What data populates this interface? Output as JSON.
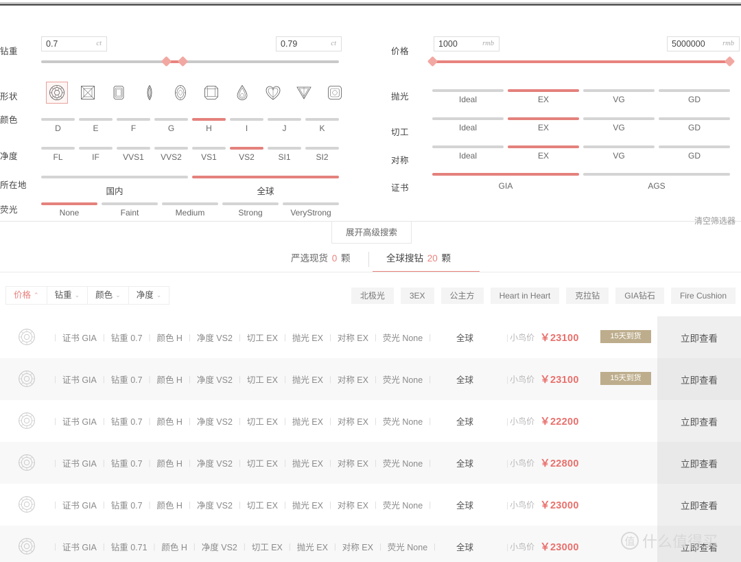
{
  "carat": {
    "label": "钻重",
    "min_value": "0.7",
    "max_value": "0.79",
    "unit": "ct",
    "placeholder": "ct"
  },
  "shape": {
    "label": "形状",
    "items": [
      {
        "name": "round-shape-icon",
        "selected": true
      },
      {
        "name": "princess-shape-icon",
        "selected": false
      },
      {
        "name": "emerald-shape-icon",
        "selected": false
      },
      {
        "name": "marquise-shape-icon",
        "selected": false
      },
      {
        "name": "oval-shape-icon",
        "selected": false
      },
      {
        "name": "radiant-shape-icon",
        "selected": false
      },
      {
        "name": "pear-shape-icon",
        "selected": false
      },
      {
        "name": "heart-shape-icon",
        "selected": false
      },
      {
        "name": "triangle-shape-icon",
        "selected": false
      },
      {
        "name": "cushion-shape-icon",
        "selected": false
      }
    ]
  },
  "color": {
    "label": "颜色",
    "options": [
      "D",
      "E",
      "F",
      "G",
      "H",
      "I",
      "J",
      "K"
    ],
    "selected": [
      "H"
    ]
  },
  "clarity": {
    "label": "净度",
    "options": [
      "FL",
      "IF",
      "VVS1",
      "VVS2",
      "VS1",
      "VS2",
      "SI1",
      "SI2"
    ],
    "selected": [
      "VS2"
    ]
  },
  "location": {
    "label": "所在地",
    "options": [
      "国内",
      "全球"
    ],
    "selected": [
      "全球"
    ]
  },
  "fluorescence": {
    "label": "荧光",
    "options": [
      "None",
      "Faint",
      "Medium",
      "Strong",
      "VeryStrong"
    ],
    "selected": [
      "None"
    ]
  },
  "price": {
    "label": "价格",
    "min_value": "1000",
    "max_value": "5000000",
    "unit": "rmb"
  },
  "polish": {
    "label": "抛光",
    "options": [
      "Ideal",
      "EX",
      "VG",
      "GD"
    ],
    "selected": [
      "EX"
    ]
  },
  "cut": {
    "label": "切工",
    "options": [
      "Ideal",
      "EX",
      "VG",
      "GD"
    ],
    "selected": [
      "EX"
    ]
  },
  "symmetry": {
    "label": "对称",
    "options": [
      "Ideal",
      "EX",
      "VG",
      "GD"
    ],
    "selected": [
      "EX"
    ]
  },
  "certificate": {
    "label": "证书",
    "options": [
      "GIA",
      "AGS"
    ],
    "selected": [
      "GIA"
    ]
  },
  "advanced_tab_label": "展开高级搜索",
  "clear_filters_label": "清空筛选器",
  "result_tabs": [
    {
      "label": "严选现货",
      "count": "0",
      "unit": "颗",
      "active": false
    },
    {
      "label": "全球搜钻",
      "count": "20",
      "unit": "颗",
      "active": true
    }
  ],
  "sort_bar": [
    {
      "label": "价格",
      "chevron": "chevron-up-icon",
      "glyph": "⌃",
      "active": true
    },
    {
      "label": "钻重",
      "chevron": "chevron-down-icon",
      "glyph": "⌄",
      "active": false
    },
    {
      "label": "颜色",
      "chevron": "chevron-down-icon",
      "glyph": "⌄",
      "active": false
    },
    {
      "label": "净度",
      "chevron": "chevron-down-icon",
      "glyph": "⌄",
      "active": false
    }
  ],
  "quick_tags": [
    "北极光",
    "3EX",
    "公主方",
    "Heart in Heart",
    "克拉钻",
    "GIA钻石",
    "Fire Cushion"
  ],
  "row_field_labels": {
    "cert": "证书",
    "carat": "钻重",
    "color": "颜色",
    "clarity": "净度",
    "cut": "切工",
    "polish": "抛光",
    "symmetry": "对称",
    "fluorescence": "荧光",
    "price_label": "小鸟价",
    "currency": "￥"
  },
  "view_button_label": "立即查看",
  "rows": [
    {
      "shape_icon": "round-diamond-icon",
      "cert": "GIA",
      "carat": "0.7",
      "color": "H",
      "clarity": "VS2",
      "cut": "EX",
      "polish": "EX",
      "symmetry": "EX",
      "fluorescence": "None",
      "origin": "全球",
      "price_label": "小鸟价",
      "price": "￥23100",
      "badge": "15天到货",
      "action": "立即查看"
    },
    {
      "shape_icon": "round-diamond-icon",
      "cert": "GIA",
      "carat": "0.7",
      "color": "H",
      "clarity": "VS2",
      "cut": "EX",
      "polish": "EX",
      "symmetry": "EX",
      "fluorescence": "None",
      "origin": "全球",
      "price_label": "小鸟价",
      "price": "￥23100",
      "badge": "15天到货",
      "action": "立即查看"
    },
    {
      "shape_icon": "round-diamond-icon",
      "cert": "GIA",
      "carat": "0.7",
      "color": "H",
      "clarity": "VS2",
      "cut": "EX",
      "polish": "EX",
      "symmetry": "EX",
      "fluorescence": "None",
      "origin": "全球",
      "price_label": "小鸟价",
      "price": "￥22200",
      "badge": "",
      "action": "立即查看"
    },
    {
      "shape_icon": "round-diamond-icon",
      "cert": "GIA",
      "carat": "0.7",
      "color": "H",
      "clarity": "VS2",
      "cut": "EX",
      "polish": "EX",
      "symmetry": "EX",
      "fluorescence": "None",
      "origin": "全球",
      "price_label": "小鸟价",
      "price": "￥22800",
      "badge": "",
      "action": "立即查看"
    },
    {
      "shape_icon": "round-diamond-icon",
      "cert": "GIA",
      "carat": "0.7",
      "color": "H",
      "clarity": "VS2",
      "cut": "EX",
      "polish": "EX",
      "symmetry": "EX",
      "fluorescence": "None",
      "origin": "全球",
      "price_label": "小鸟价",
      "price": "￥23000",
      "badge": "",
      "action": "立即查看"
    },
    {
      "shape_icon": "round-diamond-icon",
      "cert": "GIA",
      "carat": "0.71",
      "color": "H",
      "clarity": "VS2",
      "cut": "EX",
      "polish": "EX",
      "symmetry": "EX",
      "fluorescence": "None",
      "origin": "全球",
      "price_label": "小鸟价",
      "price": "￥23000",
      "badge": "",
      "action": "立即查看"
    }
  ],
  "watermark": {
    "mark": "值",
    "text": "什么值得买"
  },
  "colors": {
    "accent": "#e8827d",
    "track": "#d4d4d4",
    "badge": "#bdad8c",
    "price": "#e8706c"
  }
}
